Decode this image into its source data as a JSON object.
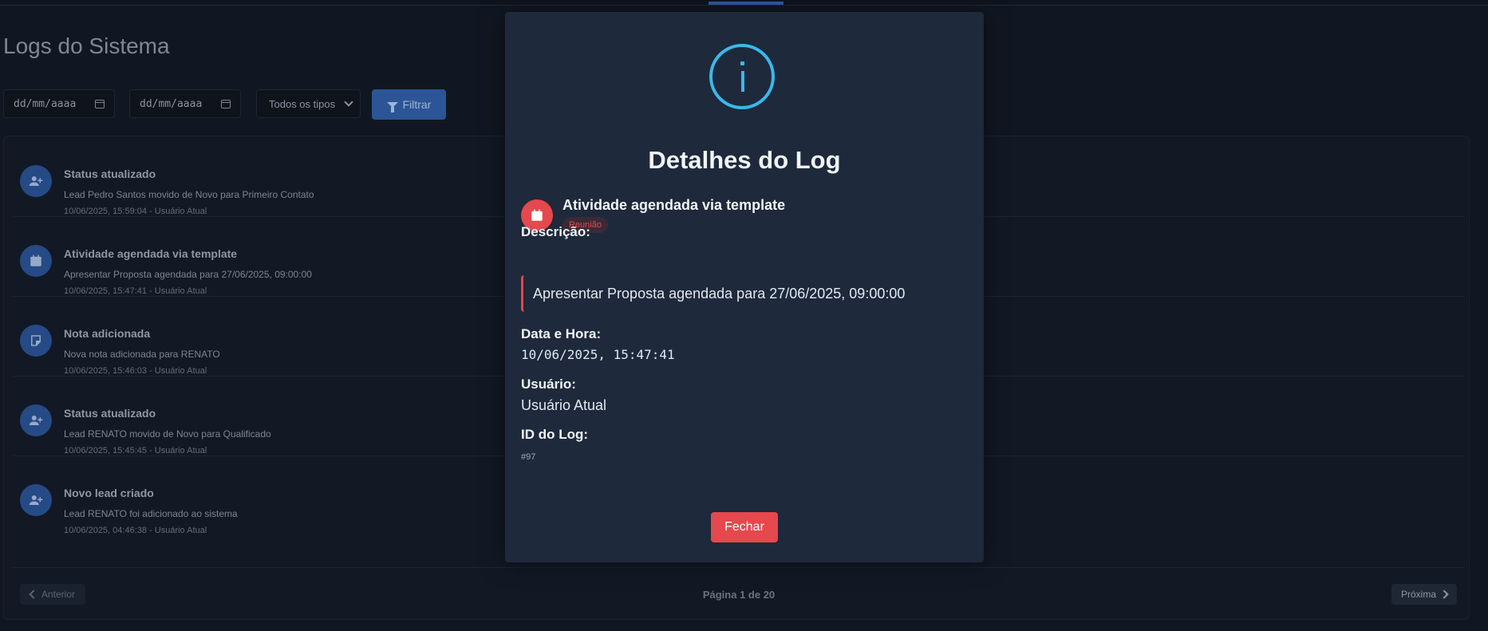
{
  "page": {
    "title": "Logs do Sistema"
  },
  "filters": {
    "date_start_placeholder": "dd/mm/aaaa",
    "date_end_placeholder": "dd/mm/aaaa",
    "type_selected": "Todos os tipos",
    "filter_label": "Filtrar"
  },
  "logs": [
    {
      "title": "Status atualizado",
      "description": "Lead Pedro Santos movido de Novo para Primeiro Contato",
      "meta": "10/06/2025, 15:59:04 - Usuário Atual",
      "icon": "user-plus-icon"
    },
    {
      "title": "Atividade agendada via template",
      "description": "Apresentar Proposta agendada para 27/06/2025, 09:00:00",
      "meta": "10/06/2025, 15:47:41 - Usuário Atual",
      "icon": "calendar-icon"
    },
    {
      "title": "Nota adicionada",
      "description": "Nova nota adicionada para RENATO",
      "meta": "10/06/2025, 15:46:03 - Usuário Atual",
      "icon": "note-icon"
    },
    {
      "title": "Status atualizado",
      "description": "Lead RENATO movido de Novo para Qualificado",
      "meta": "10/06/2025, 15:45:45 - Usuário Atual",
      "icon": "user-plus-icon"
    },
    {
      "title": "Novo lead criado",
      "description": "Lead RENATO foi adicionado ao sistema",
      "meta": "10/06/2025, 04:46:38 - Usuário Atual",
      "icon": "user-plus-icon"
    }
  ],
  "pagination": {
    "prev_label": "Anterior",
    "next_label": "Próxima",
    "info": "Página 1 de 20"
  },
  "modal": {
    "title": "Detalhes do Log",
    "activity_title": "Atividade agendada via template",
    "badge": "Reunião",
    "description_label": "Descrição:",
    "description": "Apresentar Proposta agendada para 27/06/2025, 09:00:00",
    "datetime_label": "Data e Hora:",
    "datetime": "10/06/2025, 15:47:41",
    "user_label": "Usuário:",
    "user": "Usuário Atual",
    "id_label": "ID do Log:",
    "id": "#97",
    "close_label": "Fechar"
  },
  "colors": {
    "accent": "#2b5596",
    "danger": "#e5484d",
    "info": "#3ab8ec",
    "modal_bg": "#1e293b",
    "page_bg": "#111722"
  }
}
